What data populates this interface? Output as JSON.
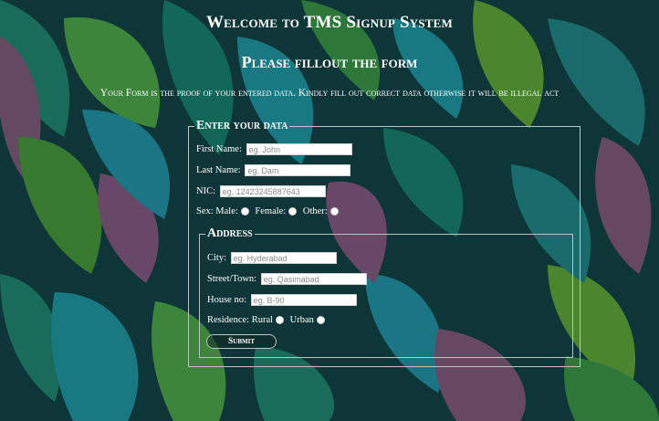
{
  "page": {
    "title": "Welcome to TMS Signup System",
    "subtitle": "Please fillout the form",
    "notice": "Your Form is the proof of your entered data. Kindly fill out correct data otherwise it will be illegal act"
  },
  "form": {
    "legend": "Enter your data",
    "first_name": {
      "label": "First Name:",
      "placeholder": "eg. John"
    },
    "last_name": {
      "label": "Last Name:",
      "placeholder": "eg. Dam"
    },
    "nic": {
      "label": "NIC:",
      "placeholder": "eg. 12423245887643"
    },
    "sex": {
      "label": "Sex:",
      "options": [
        "Male:",
        "Female:",
        "Other:"
      ]
    },
    "address": {
      "legend": "Address",
      "city": {
        "label": "City:",
        "placeholder": "eg. Hyderabad"
      },
      "street": {
        "label": "Street/Town:",
        "placeholder": "eg. Qasimabad"
      },
      "house": {
        "label": "House no:",
        "placeholder": "eg. B-90"
      },
      "residence": {
        "label": "Residence:",
        "options": [
          "Rural",
          "Urban"
        ]
      }
    },
    "submit_label": "Submit"
  },
  "colors": {
    "text": "#ffffff",
    "background": "leafy teal/green/purple pattern"
  }
}
